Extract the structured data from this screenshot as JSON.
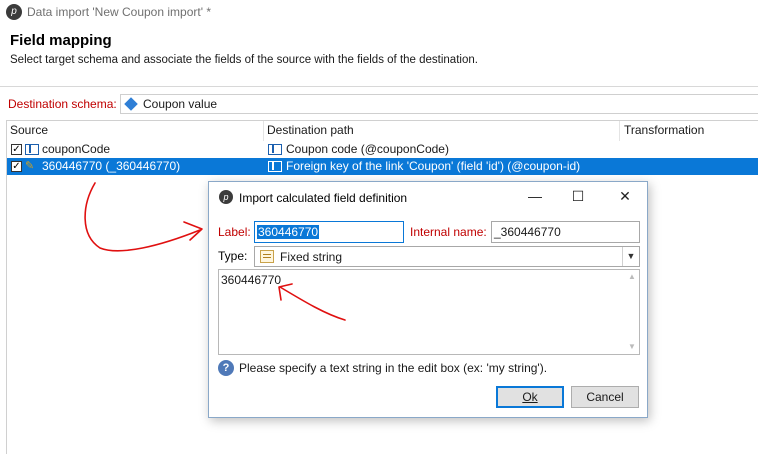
{
  "window": {
    "title": "Data import 'New Coupon import' *"
  },
  "header": {
    "title": "Field mapping",
    "description": "Select target schema and associate the fields of the source with the fields of the destination."
  },
  "schema": {
    "label": "Destination schema:",
    "value": "Coupon value"
  },
  "grid": {
    "columns": [
      "Source",
      "Destination path",
      "Transformation"
    ],
    "rows": [
      {
        "checked": true,
        "source": "couponCode",
        "destination": "Coupon code (@couponCode)",
        "transformation": "",
        "selected": false
      },
      {
        "checked": true,
        "source": "360446770 (_360446770)",
        "destination": "Foreign key of the link 'Coupon' (field 'id') (@coupon-id)",
        "transformation": "",
        "selected": true
      }
    ]
  },
  "dialog": {
    "title": "Import calculated field definition",
    "minimize": "—",
    "maximize": "☐",
    "close": "✕",
    "label_caption": "Label:",
    "label_value": "360446770",
    "internal_caption": "Internal name:",
    "internal_value": "_360446770",
    "type_caption": "Type:",
    "type_value": "Fixed string",
    "text_value": "360446770",
    "help_text": "Please specify a text string in the edit box (ex: 'my string').",
    "ok_label": "Ok",
    "cancel_label": "Cancel"
  },
  "icons": {
    "app": "adobe-campaign-icon",
    "schema": "schema-diamond-icon",
    "field": "field-icon",
    "calculated": "calculated-field-icon",
    "type": "fixed-string-icon",
    "help": "help-icon"
  },
  "colors": {
    "selection": "#0a78d7",
    "required_label": "#c00000",
    "annotation": "#e01010"
  }
}
